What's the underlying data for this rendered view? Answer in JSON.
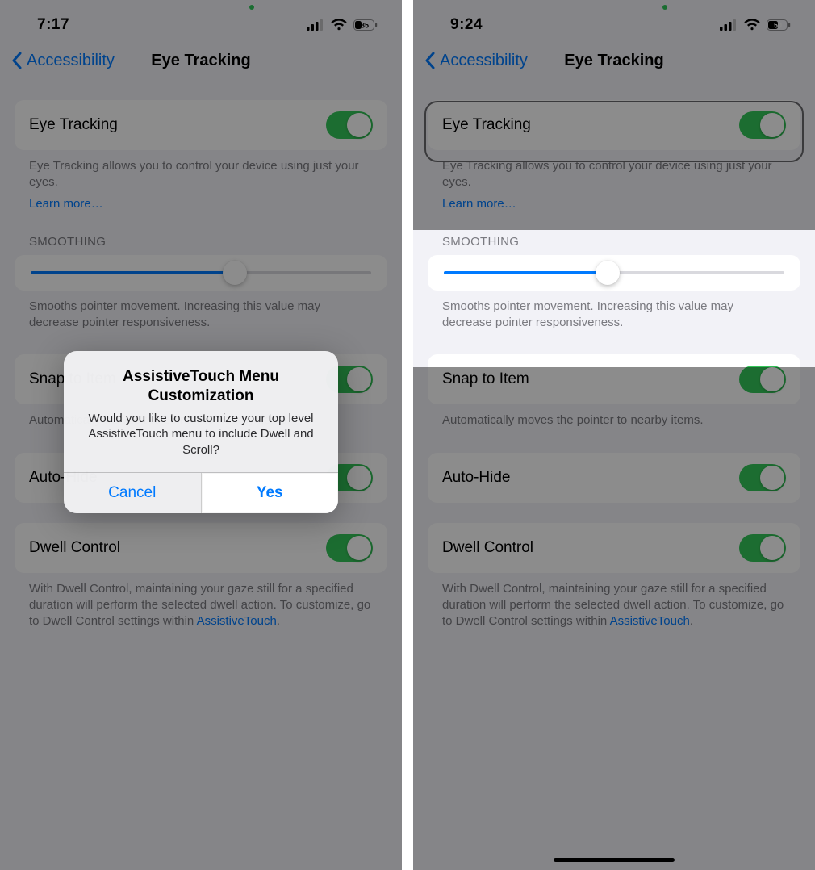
{
  "left": {
    "statusbar": {
      "time": "7:17",
      "battery_text": "35"
    },
    "nav": {
      "back_label": "Accessibility",
      "title": "Eye Tracking"
    },
    "eye_tracking": {
      "label": "Eye Tracking",
      "desc": "Eye Tracking allows you to control your device using just your eyes.",
      "learn_more": "Learn more…"
    },
    "smoothing": {
      "header": "SMOOTHING",
      "value_pct": 60,
      "desc": "Smooths pointer movement. Increasing this value may decrease pointer responsiveness."
    },
    "snap": {
      "label": "Snap to Item",
      "desc": "Automatically moves the pointer to nearby items."
    },
    "autohide": {
      "label": "Auto-Hide"
    },
    "dwell": {
      "label": "Dwell Control",
      "desc_pre": "With Dwell Control, maintaining your gaze still for a specified duration will perform the selected dwell action. To customize, go to Dwell Control settings within ",
      "link": "AssistiveTouch",
      "desc_post": "."
    },
    "alert": {
      "title": "AssistiveTouch Menu Customization",
      "message": "Would you like to customize your top level AssistiveTouch menu to include Dwell and Scroll?",
      "cancel": "Cancel",
      "confirm": "Yes"
    }
  },
  "right": {
    "statusbar": {
      "time": "9:24",
      "battery_text": "50"
    },
    "nav": {
      "back_label": "Accessibility",
      "title": "Eye Tracking"
    },
    "eye_tracking": {
      "label": "Eye Tracking",
      "desc": "Eye Tracking allows you to control your device using just your eyes.",
      "learn_more": "Learn more…"
    },
    "smoothing": {
      "header": "SMOOTHING",
      "value_pct": 48,
      "desc": "Smooths pointer movement. Increasing this value may decrease pointer responsiveness."
    },
    "snap": {
      "label": "Snap to Item",
      "desc": "Automatically moves the pointer to nearby items."
    },
    "autohide": {
      "label": "Auto-Hide"
    },
    "dwell": {
      "label": "Dwell Control",
      "desc_pre": "With Dwell Control, maintaining your gaze still for a specified duration will perform the selected dwell action. To customize, go to Dwell Control settings within ",
      "link": "AssistiveTouch",
      "desc_post": "."
    }
  }
}
